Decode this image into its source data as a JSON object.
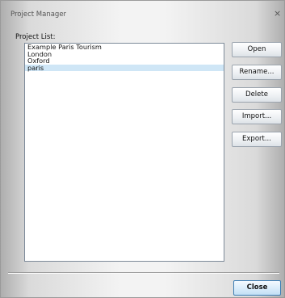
{
  "window": {
    "title": "Project Manager",
    "close_glyph": "×"
  },
  "project_list": {
    "label": "Project List:",
    "items": [
      {
        "label": "Example Paris Tourism",
        "selected": false
      },
      {
        "label": "London",
        "selected": false
      },
      {
        "label": "Oxford",
        "selected": false
      },
      {
        "label": "paris",
        "selected": true
      }
    ]
  },
  "buttons": {
    "open": "Open",
    "rename": "Rename...",
    "delete": "Delete",
    "import": "Import...",
    "export": "Export...",
    "close": "Close"
  },
  "colors": {
    "selection_highlight": "#cfe6f6",
    "default_button_border": "#3f7fb5"
  }
}
